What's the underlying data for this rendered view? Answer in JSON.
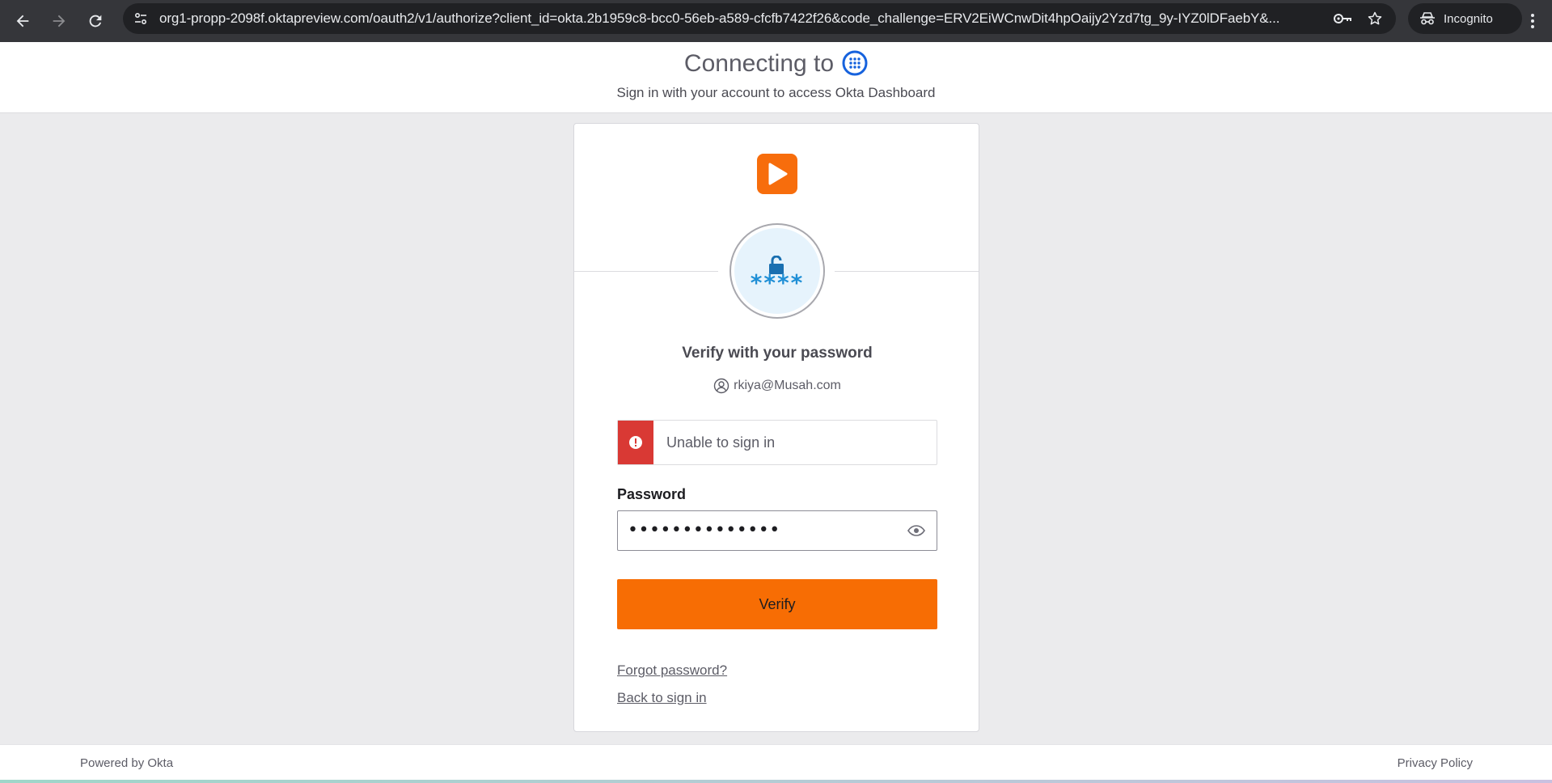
{
  "browser": {
    "url": "org1-propp-2098f.oktapreview.com/oauth2/v1/authorize?client_id=okta.2b1959c8-bcc0-56eb-a589-cfcfb7422f26&code_challenge=ERV2EiWCnwDit4hpOaijy2Yzd7tg_9y-IYZ0lDFaebY&...",
    "incognito_label": "Incognito"
  },
  "header": {
    "connecting_text": "Connecting to",
    "subtitle": "Sign in with your account to access Okta Dashboard"
  },
  "card": {
    "stars": "****",
    "title": "Verify with your password",
    "identifier": "rkiya@Musah.com",
    "error_message": "Unable to sign in",
    "password_label": "Password",
    "password_value": "••••••••••••••",
    "verify_label": "Verify",
    "forgot_link": "Forgot password?",
    "back_link": "Back to sign in"
  },
  "footer": {
    "powered_by": "Powered by Okta",
    "privacy": "Privacy Policy"
  },
  "colors": {
    "brand_orange": "#f76d04",
    "error_red": "#d93934",
    "app_icon_blue": "#1662dd",
    "badge_blue": "#1f8fd6"
  },
  "icons": [
    "back-arrow-icon",
    "forward-arrow-icon",
    "reload-icon",
    "site-info-icon",
    "key-icon",
    "star-icon",
    "incognito-icon",
    "more-vert-icon",
    "okta-dashboard-icon",
    "play-logo-icon",
    "unlock-icon",
    "user-icon",
    "alert-icon",
    "eye-icon"
  ]
}
